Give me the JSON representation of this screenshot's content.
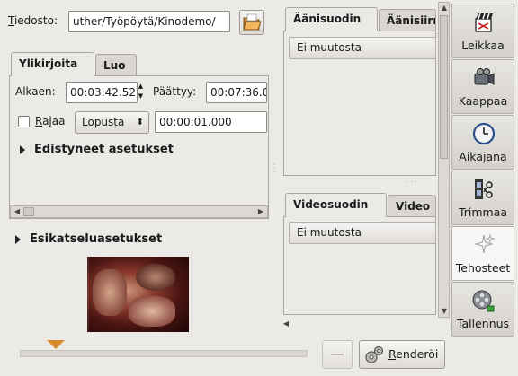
{
  "file": {
    "label": "Tiedosto:",
    "path": "uther/Työpöytä/Kinodemo/"
  },
  "left_tabs": [
    {
      "label": "Ylikirjoita",
      "active": true
    },
    {
      "label": "Luo",
      "active": false
    }
  ],
  "start": {
    "label": "Alkaen:",
    "value": "00:03:42.52"
  },
  "end": {
    "label": "Päättyy:",
    "value": "00:07:36.0"
  },
  "limit": {
    "checkbox_label": "Rajaa",
    "checked": false,
    "mode": "Lopusta",
    "duration": "00:00:01.000"
  },
  "advanced_label": "Edistyneet asetukset",
  "preview_settings_label": "Esikatseluasetukset",
  "audio": {
    "tabs": [
      {
        "label": "Äänisuodin",
        "active": true
      },
      {
        "label": "Äänisiirr",
        "active": false
      }
    ],
    "value": "Ei muutosta"
  },
  "video": {
    "tabs": [
      {
        "label": "Videosuodin",
        "active": true
      },
      {
        "label": "Video",
        "active": false
      }
    ],
    "value": "Ei muutosta"
  },
  "render_button": "Renderöi",
  "sidebar": [
    {
      "label": "Leikkaa",
      "icon": "clapperboard-cut-icon",
      "active": false
    },
    {
      "label": "Kaappaa",
      "icon": "camcorder-icon",
      "active": false
    },
    {
      "label": "Aikajana",
      "icon": "clock-icon",
      "active": false
    },
    {
      "label": "Trimmaa",
      "icon": "film-scissors-icon",
      "active": false
    },
    {
      "label": "Tehosteet",
      "icon": "sparkles-icon",
      "active": true
    },
    {
      "label": "Tallennus",
      "icon": "film-reel-save-icon",
      "active": false
    }
  ],
  "colors": {
    "accent": "#d98a2c",
    "background": "#eceae6"
  }
}
